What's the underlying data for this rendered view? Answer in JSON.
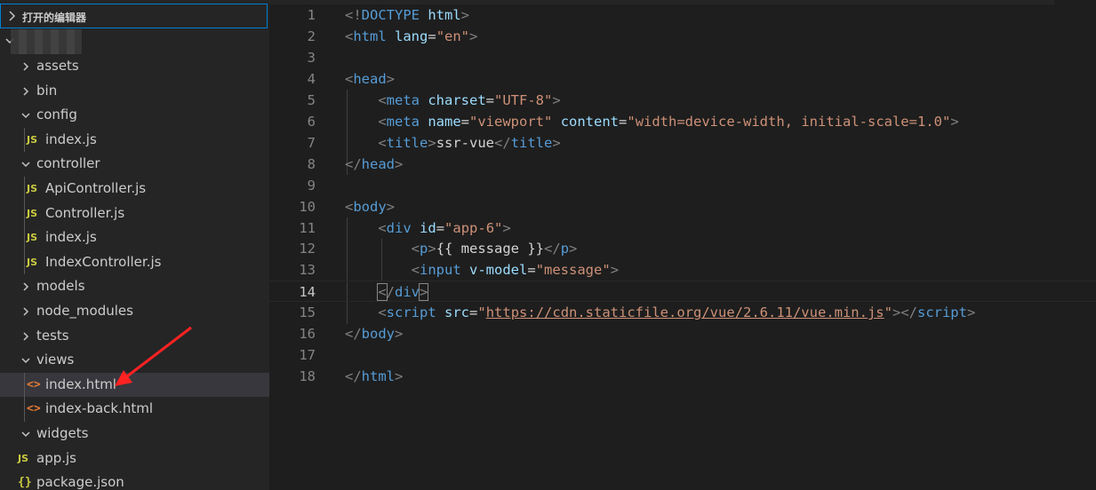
{
  "sidebar": {
    "open_editors_label": "打开的编辑器",
    "items": [
      {
        "label": "assets",
        "type": "folder",
        "expanded": false,
        "depth": 1
      },
      {
        "label": "bin",
        "type": "folder",
        "expanded": false,
        "depth": 1
      },
      {
        "label": "config",
        "type": "folder",
        "expanded": true,
        "depth": 1
      },
      {
        "label": "index.js",
        "type": "js",
        "depth": 2
      },
      {
        "label": "controller",
        "type": "folder",
        "expanded": true,
        "depth": 1
      },
      {
        "label": "ApiController.js",
        "type": "js",
        "depth": 2
      },
      {
        "label": "Controller.js",
        "type": "js",
        "depth": 2
      },
      {
        "label": "index.js",
        "type": "js",
        "depth": 2
      },
      {
        "label": "IndexController.js",
        "type": "js",
        "depth": 2
      },
      {
        "label": "models",
        "type": "folder",
        "expanded": false,
        "depth": 1
      },
      {
        "label": "node_modules",
        "type": "folder",
        "expanded": false,
        "depth": 1
      },
      {
        "label": "tests",
        "type": "folder",
        "expanded": false,
        "depth": 1
      },
      {
        "label": "views",
        "type": "folder",
        "expanded": true,
        "depth": 1
      },
      {
        "label": "index.html",
        "type": "html",
        "depth": 2,
        "selected": true
      },
      {
        "label": "index-back.html",
        "type": "html",
        "depth": 2
      },
      {
        "label": "widgets",
        "type": "folder",
        "expanded": true,
        "depth": 1
      },
      {
        "label": "app.js",
        "type": "js",
        "depth": 1
      },
      {
        "label": "package.json",
        "type": "json",
        "depth": 1
      }
    ],
    "js_badge": "JS",
    "html_badge": "<>",
    "json_badge": "{}"
  },
  "editor": {
    "active_line": 14,
    "lines": [
      {
        "n": "1",
        "tokens": [
          [
            "t",
            "<!"
          ],
          [
            "tag",
            "DOCTYPE"
          ],
          [
            "txt",
            " "
          ],
          [
            "attr",
            "html"
          ],
          [
            "t",
            ">"
          ]
        ]
      },
      {
        "n": "2",
        "tokens": [
          [
            "t",
            "<"
          ],
          [
            "tag",
            "html"
          ],
          [
            "txt",
            " "
          ],
          [
            "attr",
            "lang"
          ],
          [
            "txt",
            "="
          ],
          [
            "str",
            "\"en\""
          ],
          [
            "t",
            ">"
          ]
        ]
      },
      {
        "n": "3",
        "tokens": []
      },
      {
        "n": "4",
        "tokens": [
          [
            "t",
            "<"
          ],
          [
            "tag",
            "head"
          ],
          [
            "t",
            ">"
          ]
        ]
      },
      {
        "n": "5",
        "tokens": [
          [
            "txt",
            "    "
          ],
          [
            "t",
            "<"
          ],
          [
            "tag",
            "meta"
          ],
          [
            "txt",
            " "
          ],
          [
            "attr",
            "charset"
          ],
          [
            "txt",
            "="
          ],
          [
            "str",
            "\"UTF-8\""
          ],
          [
            "t",
            ">"
          ]
        ]
      },
      {
        "n": "6",
        "tokens": [
          [
            "txt",
            "    "
          ],
          [
            "t",
            "<"
          ],
          [
            "tag",
            "meta"
          ],
          [
            "txt",
            " "
          ],
          [
            "attr",
            "name"
          ],
          [
            "txt",
            "="
          ],
          [
            "str",
            "\"viewport\""
          ],
          [
            "txt",
            " "
          ],
          [
            "attr",
            "content"
          ],
          [
            "txt",
            "="
          ],
          [
            "str",
            "\"width=device-width, initial-scale=1.0\""
          ],
          [
            "t",
            ">"
          ]
        ]
      },
      {
        "n": "7",
        "tokens": [
          [
            "txt",
            "    "
          ],
          [
            "t",
            "<"
          ],
          [
            "tag",
            "title"
          ],
          [
            "t",
            ">"
          ],
          [
            "txt",
            "ssr-vue"
          ],
          [
            "t",
            "</"
          ],
          [
            "tag",
            "title"
          ],
          [
            "t",
            ">"
          ]
        ]
      },
      {
        "n": "8",
        "tokens": [
          [
            "t",
            "</"
          ],
          [
            "tag",
            "head"
          ],
          [
            "t",
            ">"
          ]
        ]
      },
      {
        "n": "9",
        "tokens": []
      },
      {
        "n": "10",
        "tokens": [
          [
            "t",
            "<"
          ],
          [
            "tag",
            "body"
          ],
          [
            "t",
            ">"
          ]
        ]
      },
      {
        "n": "11",
        "tokens": [
          [
            "txt",
            "    "
          ],
          [
            "t",
            "<"
          ],
          [
            "tag",
            "div"
          ],
          [
            "txt",
            " "
          ],
          [
            "attr",
            "id"
          ],
          [
            "txt",
            "="
          ],
          [
            "str",
            "\"app-6\""
          ],
          [
            "t",
            ">"
          ]
        ]
      },
      {
        "n": "12",
        "tokens": [
          [
            "txt",
            "        "
          ],
          [
            "t",
            "<"
          ],
          [
            "tag",
            "p"
          ],
          [
            "t",
            ">"
          ],
          [
            "txt",
            "{{ message }}"
          ],
          [
            "t",
            "</"
          ],
          [
            "tag",
            "p"
          ],
          [
            "t",
            ">"
          ]
        ]
      },
      {
        "n": "13",
        "tokens": [
          [
            "txt",
            "        "
          ],
          [
            "t",
            "<"
          ],
          [
            "tag",
            "input"
          ],
          [
            "txt",
            " "
          ],
          [
            "attr",
            "v-model"
          ],
          [
            "txt",
            "="
          ],
          [
            "str",
            "\"message\""
          ],
          [
            "t",
            ">"
          ]
        ]
      },
      {
        "n": "14",
        "tokens": [
          [
            "txt",
            "    "
          ],
          [
            "tbox",
            "<"
          ],
          [
            "t",
            "/"
          ],
          [
            "tag",
            "div"
          ],
          [
            "tbox",
            ">"
          ]
        ]
      },
      {
        "n": "15",
        "tokens": [
          [
            "txt",
            "    "
          ],
          [
            "t",
            "<"
          ],
          [
            "tag",
            "script"
          ],
          [
            "txt",
            " "
          ],
          [
            "attr",
            "src"
          ],
          [
            "txt",
            "="
          ],
          [
            "str",
            "\""
          ],
          [
            "url",
            "https://cdn.staticfile.org/vue/2.6.11/vue.min.js"
          ],
          [
            "str",
            "\""
          ],
          [
            "t",
            "></"
          ],
          [
            "tag",
            "script"
          ],
          [
            "t",
            ">"
          ]
        ]
      },
      {
        "n": "16",
        "tokens": [
          [
            "t",
            "</"
          ],
          [
            "tag",
            "body"
          ],
          [
            "t",
            ">"
          ]
        ]
      },
      {
        "n": "17",
        "tokens": []
      },
      {
        "n": "18",
        "tokens": [
          [
            "t",
            "</"
          ],
          [
            "tag",
            "html"
          ],
          [
            "t",
            ">"
          ]
        ]
      }
    ]
  }
}
